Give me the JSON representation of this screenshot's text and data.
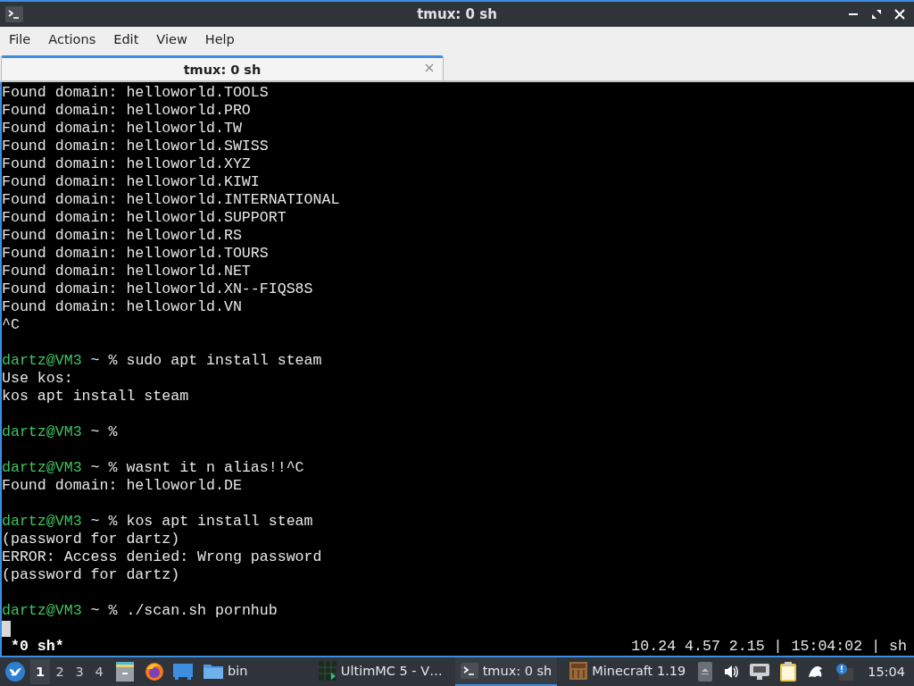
{
  "window": {
    "title": "tmux: 0 sh"
  },
  "menu": [
    "File",
    "Actions",
    "Edit",
    "View",
    "Help"
  ],
  "tabs": [
    {
      "label": "tmux: 0 sh",
      "selected": true
    }
  ],
  "terminal": {
    "lines": [
      {
        "kind": "output",
        "text": "Found domain: helloworld.TOOLS"
      },
      {
        "kind": "output",
        "text": "Found domain: helloworld.PRO"
      },
      {
        "kind": "output",
        "text": "Found domain: helloworld.TW"
      },
      {
        "kind": "output",
        "text": "Found domain: helloworld.SWISS"
      },
      {
        "kind": "output",
        "text": "Found domain: helloworld.XYZ"
      },
      {
        "kind": "output",
        "text": "Found domain: helloworld.KIWI"
      },
      {
        "kind": "output",
        "text": "Found domain: helloworld.INTERNATIONAL"
      },
      {
        "kind": "output",
        "text": "Found domain: helloworld.SUPPORT"
      },
      {
        "kind": "output",
        "text": "Found domain: helloworld.RS"
      },
      {
        "kind": "output",
        "text": "Found domain: helloworld.TOURS"
      },
      {
        "kind": "output",
        "text": "Found domain: helloworld.NET"
      },
      {
        "kind": "output",
        "text": "Found domain: helloworld.XN--FIQS8S"
      },
      {
        "kind": "output",
        "text": "Found domain: helloworld.VN"
      },
      {
        "kind": "output",
        "text": "^C"
      },
      {
        "kind": "blank"
      },
      {
        "kind": "prompt",
        "user": "dartz@VM3",
        "text": "~ % sudo apt install steam"
      },
      {
        "kind": "output",
        "text": "Use kos:"
      },
      {
        "kind": "output",
        "text": "kos apt install steam"
      },
      {
        "kind": "blank"
      },
      {
        "kind": "prompt",
        "user": "dartz@VM3",
        "text": "~ %"
      },
      {
        "kind": "blank"
      },
      {
        "kind": "prompt",
        "user": "dartz@VM3",
        "text": "~ % wasnt it n alias!!^C"
      },
      {
        "kind": "output",
        "text": "Found domain: helloworld.DE"
      },
      {
        "kind": "blank"
      },
      {
        "kind": "prompt",
        "user": "dartz@VM3",
        "text": "~ % kos apt install steam"
      },
      {
        "kind": "output",
        "text": "(password for dartz)"
      },
      {
        "kind": "output",
        "text": "ERROR: Access denied: Wrong password"
      },
      {
        "kind": "output",
        "text": "(password for dartz)"
      },
      {
        "kind": "blank"
      },
      {
        "kind": "prompt",
        "user": "dartz@VM3",
        "text": "~ % ./scan.sh pornhub"
      },
      {
        "kind": "cursor"
      }
    ],
    "status_left": "*0 sh*",
    "status_right": "10.24 4.57 2.15 | 15:04:02 | sh"
  },
  "taskbar": {
    "workspaces": [
      {
        "label": "1",
        "selected": true
      },
      {
        "label": "2",
        "selected": false
      },
      {
        "label": "3",
        "selected": false
      },
      {
        "label": "4",
        "selected": false
      }
    ],
    "folder": "bin",
    "tasks": [
      {
        "kind": "ultimmc",
        "label": "UltimMC 5 - V…",
        "selected": false
      },
      {
        "kind": "terminal",
        "label": "tmux: 0 sh",
        "selected": true
      },
      {
        "kind": "minecraft",
        "label": "Minecraft 1.19",
        "selected": false
      }
    ],
    "clock": "15:04"
  }
}
